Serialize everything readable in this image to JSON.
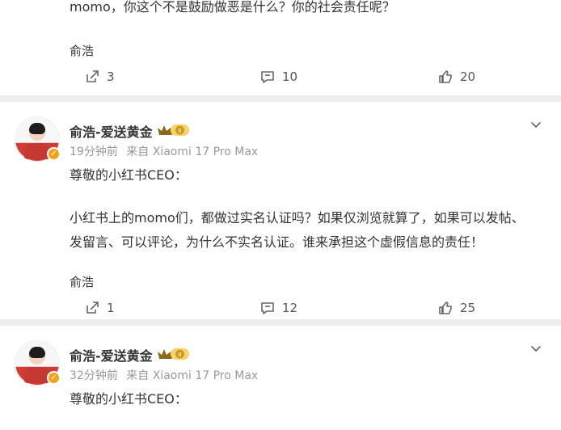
{
  "comments": [
    {
      "text_lines": [
        "momo，你这个不是鼓励做恶是什么？你的社会责任呢？"
      ],
      "signature": "俞浩",
      "actions": {
        "share_count": "3",
        "comment_count": "10",
        "like_count": "20"
      }
    },
    {
      "username": "俞浩-爱送黄金",
      "badge_level": "II",
      "time": "19分钟前",
      "source": "来自 Xiaomi 17 Pro Max",
      "greeting": "尊敬的小红书CEO：",
      "paragraph_lines": [
        "小红书上的momo们，都做过实名认证吗？如果仅浏览就算了，如果可以发帖、",
        "发留言、可以评论，为什么不实名认证。谁来承担这个虚假信息的责任！"
      ],
      "signature": "俞浩",
      "actions": {
        "share_count": "1",
        "comment_count": "12",
        "like_count": "25"
      }
    },
    {
      "username": "俞浩-爱送黄金",
      "badge_level": "II",
      "time": "32分钟前",
      "source": "来自 Xiaomi 17 Pro Max",
      "greeting": "尊敬的小红书CEO："
    }
  ],
  "colors": {
    "background": "#eeeeee",
    "card": "#ffffff",
    "text": "#333333",
    "muted": "#999999",
    "accent": "#f2a31b"
  },
  "icons": {
    "share": "share-icon",
    "comment": "comment-icon",
    "like": "thumbs-up-icon",
    "more": "chevron-down-icon",
    "verified": "verified-badge-icon",
    "member": "crown-badge-icon"
  }
}
